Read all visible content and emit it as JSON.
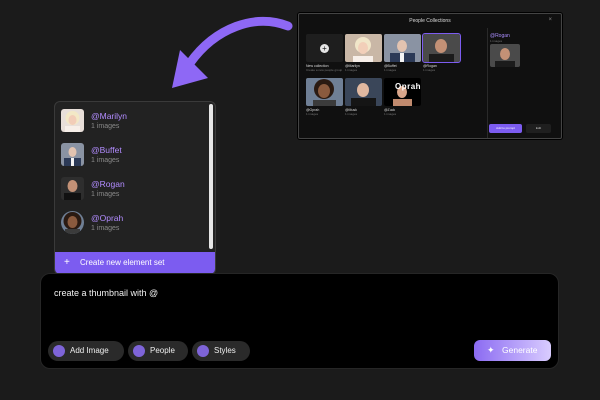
{
  "colors": {
    "accent": "#7c5cf0",
    "accent_text": "#b28cff",
    "background": "#1b1b1b"
  },
  "preview": {
    "title": "People Collections",
    "close_icon": "close-icon",
    "cards": [
      {
        "name": "New collection",
        "sub": "Create a new people group"
      },
      {
        "name": "@Marilyn",
        "sub": "1 images"
      },
      {
        "name": "@Buffet",
        "sub": "1 images"
      },
      {
        "name": "@Rogan",
        "sub": "1 images"
      },
      {
        "name": "@Oprah",
        "sub": "1 images"
      },
      {
        "name": "@Musk",
        "sub": "1 images"
      },
      {
        "name": "@Zuck",
        "sub": "1 images"
      }
    ],
    "zuck_tag": "Oprah",
    "selected": {
      "name": "@Rogan",
      "sub": "1 images"
    },
    "primary_button": "Add to prompt",
    "secondary_button": "Edit"
  },
  "dropdown": {
    "items": [
      {
        "name": "@Marilyn",
        "count": "1 images"
      },
      {
        "name": "@Buffet",
        "count": "1 images"
      },
      {
        "name": "@Rogan",
        "count": "1 images"
      },
      {
        "name": "@Oprah",
        "count": "1 images"
      }
    ],
    "footer_label": "Create new element set"
  },
  "prompt": {
    "text": "create a thumbnail with @",
    "buttons": {
      "add_image": "Add Image",
      "people": "People",
      "styles": "Styles"
    },
    "generate": "Generate"
  }
}
